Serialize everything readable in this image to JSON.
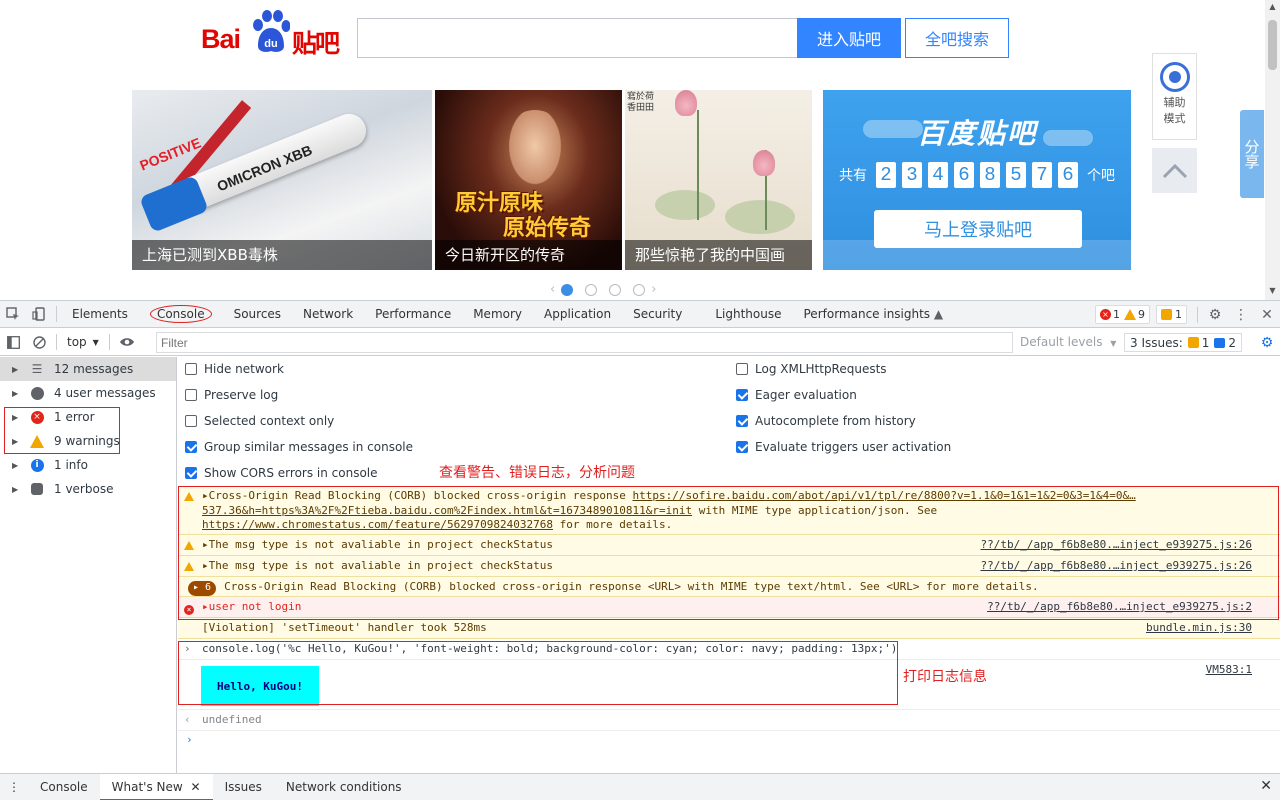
{
  "webpage": {
    "logo": {
      "bai": "Bai",
      "du": "du",
      "tieba": "贴吧"
    },
    "search_placeholder": "",
    "btn_enter": "进入贴吧",
    "btn_all": "全吧搜索",
    "banners": [
      {
        "caption": "上海已测到XBB毒株",
        "tube_label": "OMICRON XBB",
        "red_label": "POSITIVE"
      },
      {
        "caption": "今日新开区的传奇",
        "title1": "原汁原味",
        "title2": "原始传奇"
      },
      {
        "caption": "那些惊艳了我的中国画",
        "poem": "寫於荷香田田"
      }
    ],
    "tieba_banner": {
      "title": "百度贴吧",
      "prefix": "共有",
      "digits": [
        "2",
        "3",
        "4",
        "6",
        "8",
        "5",
        "7",
        "6"
      ],
      "suffix": "个吧",
      "login": "马上登录贴吧"
    },
    "assist_label_1": "辅助",
    "assist_label_2": "模式",
    "share": "分享",
    "carousel_active": 0
  },
  "devtools": {
    "tabs": [
      "Elements",
      "Console",
      "Sources",
      "Network",
      "Performance",
      "Memory",
      "Application",
      "Security",
      "Lighthouse",
      "Performance insights"
    ],
    "selected_tab": "Console",
    "error_count": "1",
    "warning_count": "9",
    "issue_count": "1",
    "toolbar": {
      "context": "top",
      "filter_placeholder": "Filter",
      "levels": "Default levels",
      "issues_label": "3 Issues:",
      "issues_warn": "1",
      "issues_info": "2"
    },
    "sidebar": [
      {
        "label": "12 messages",
        "icon": "list-icon"
      },
      {
        "label": "4 user messages",
        "icon": "user-icon"
      },
      {
        "label": "1 error",
        "icon": "error-icon"
      },
      {
        "label": "9 warnings",
        "icon": "warning-icon"
      },
      {
        "label": "1 info",
        "icon": "info-icon"
      },
      {
        "label": "1 verbose",
        "icon": "bug-icon"
      }
    ],
    "settings_left": [
      {
        "label": "Hide network",
        "checked": false
      },
      {
        "label": "Preserve log",
        "checked": false
      },
      {
        "label": "Selected context only",
        "checked": false
      },
      {
        "label": "Group similar messages in console",
        "checked": true
      },
      {
        "label": "Show CORS errors in console",
        "checked": true
      }
    ],
    "settings_right": [
      {
        "label": "Log XMLHttpRequests",
        "checked": false
      },
      {
        "label": "Eager evaluation",
        "checked": true
      },
      {
        "label": "Autocomplete from history",
        "checked": true
      },
      {
        "label": "Evaluate triggers user activation",
        "checked": true
      }
    ],
    "annotation_warn": "查看警告、错误日志，分析问题",
    "annotation_log": "打印日志信息",
    "messages": {
      "corb1_prefix": "Cross-Origin Read Blocking (CORB) blocked cross-origin response ",
      "corb1_url": "https://sofire.baidu.com/abot/api/v1/tpl/re/8800?v=1.1&0=1&1=1&2=0&3=1&4=0&…537.36&h=https%3A%2F%2Ftieba.baidu.com%2Findex.html&t=1673489010811&r=init",
      "corb1_mid": " with MIME type application/json. See ",
      "corb1_see": "https://www.chromestatus.com/feature/5629709824032768",
      "corb1_suffix": " for more details.",
      "msgtype1": "The msg type is not avaliable in project checkStatus",
      "msgtype1_src": "??/tb/_/app_f6b8e80.…inject_e939275.js:26",
      "msgtype2": "The msg type is not avaliable in project checkStatus",
      "msgtype2_src": "??/tb/_/app_f6b8e80.…inject_e939275.js:26",
      "group_count": "6",
      "corb2": "Cross-Origin Read Blocking (CORB) blocked cross-origin response <URL> with MIME type text/html. See <URL> for more details.",
      "error": "user not login",
      "error_src": "??/tb/_/app_f6b8e80.…inject_e939275.js:2",
      "violation": "[Violation] 'setTimeout' handler took 528ms",
      "violation_src": "bundle.min.js:30",
      "command": "console.log('%c Hello, KuGou!', 'font-weight: bold; background-color: cyan; color: navy; padding: 13px;')",
      "hello": "Hello, KuGou!",
      "hello_src": "VM583:1",
      "result": "undefined"
    },
    "drawer_tabs": [
      "Console",
      "What's New",
      "Issues",
      "Network conditions"
    ],
    "drawer_selected": "What's New"
  }
}
